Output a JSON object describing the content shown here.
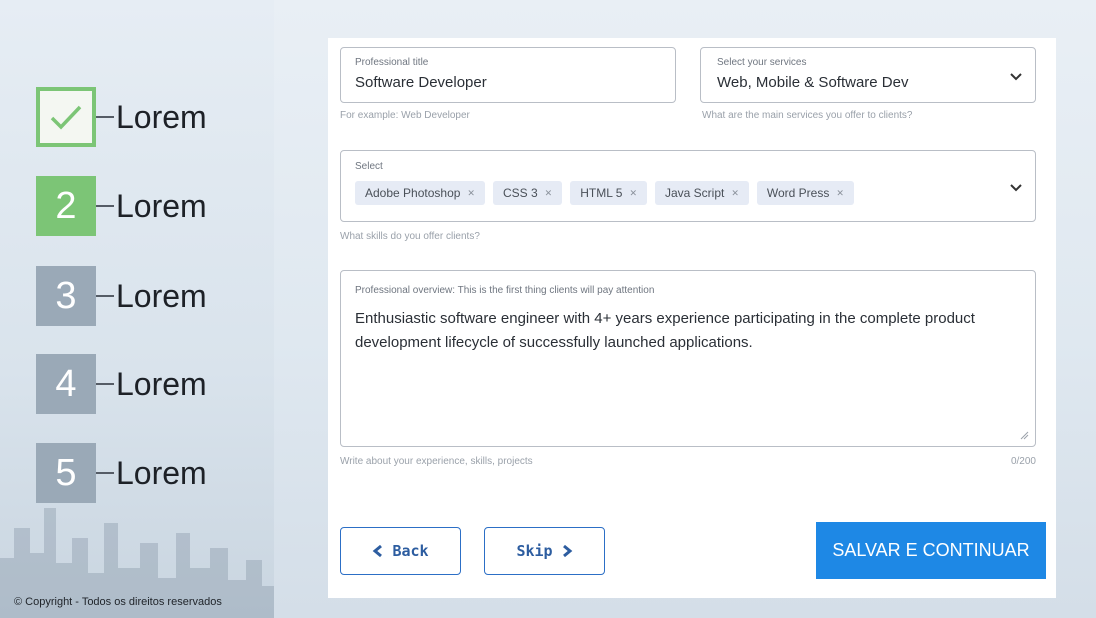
{
  "steps": [
    {
      "number": "",
      "label": "Lorem",
      "state": "done",
      "icon": "check-icon"
    },
    {
      "number": "2",
      "label": "Lorem",
      "state": "active"
    },
    {
      "number": "3",
      "label": "Lorem",
      "state": "todo"
    },
    {
      "number": "4",
      "label": "Lorem",
      "state": "todo"
    },
    {
      "number": "5",
      "label": "Lorem",
      "state": "todo"
    }
  ],
  "copyright": "© Copyright - Todos os direitos reservados",
  "form": {
    "title_field": {
      "label": "Professional title",
      "value": "Software Developer",
      "helper": "For example: Web Developer"
    },
    "services_field": {
      "label": "Select your services",
      "value": "Web, Mobile & Software Dev",
      "helper": "What are the main services you offer to clients?"
    },
    "skills_field": {
      "label": "Select",
      "chips": [
        "Adobe Photoshop",
        "CSS 3",
        "HTML 5",
        "Java Script",
        "Word Press"
      ],
      "helper": "What skills do you offer clients?"
    },
    "overview_field": {
      "label": "Professional overview: This is the first thing clients will pay attention",
      "value": "Enthusiastic software engineer with 4+ years experience participating in the complete product development lifecycle of successfully launched applications.",
      "helper": "Write about your experience, skills, projects",
      "counter": "0/200"
    }
  },
  "buttons": {
    "back_label": "Back",
    "skip_label": "Skip",
    "save_label": "SALVAR E CONTINUAR"
  },
  "colors": {
    "step_done_border": "#7cc576",
    "step_active": "#7cc576",
    "step_todo": "#9aa9b7",
    "primary_button": "#1e88e5",
    "outline_button": "#2c6fc6",
    "chip_bg": "#e6ebf5"
  }
}
